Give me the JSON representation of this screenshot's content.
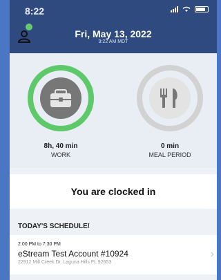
{
  "status_bar": {
    "time": "8:22"
  },
  "header": {
    "date": "Fri, May 13, 2022",
    "time_sub": "9:22 AM MDT"
  },
  "work": {
    "value": "8h, 40 min",
    "label": "WORK",
    "ring_color": "#5dc96b",
    "fill_fraction": 1.0
  },
  "meal": {
    "value": "0 min",
    "label": "MEAL PERIOD",
    "ring_color": "#cfcfcf",
    "fill_fraction": 0
  },
  "clock_status": "You are clocked in",
  "schedule": {
    "heading": "TODAY'S SCHEDULE!",
    "items": [
      {
        "time": "2:00 PM to 7:30 PM",
        "name": "eStream Test Account #10924",
        "address": "22912 Mill Creek Dr. Laguna Hills FL 92653"
      }
    ]
  }
}
